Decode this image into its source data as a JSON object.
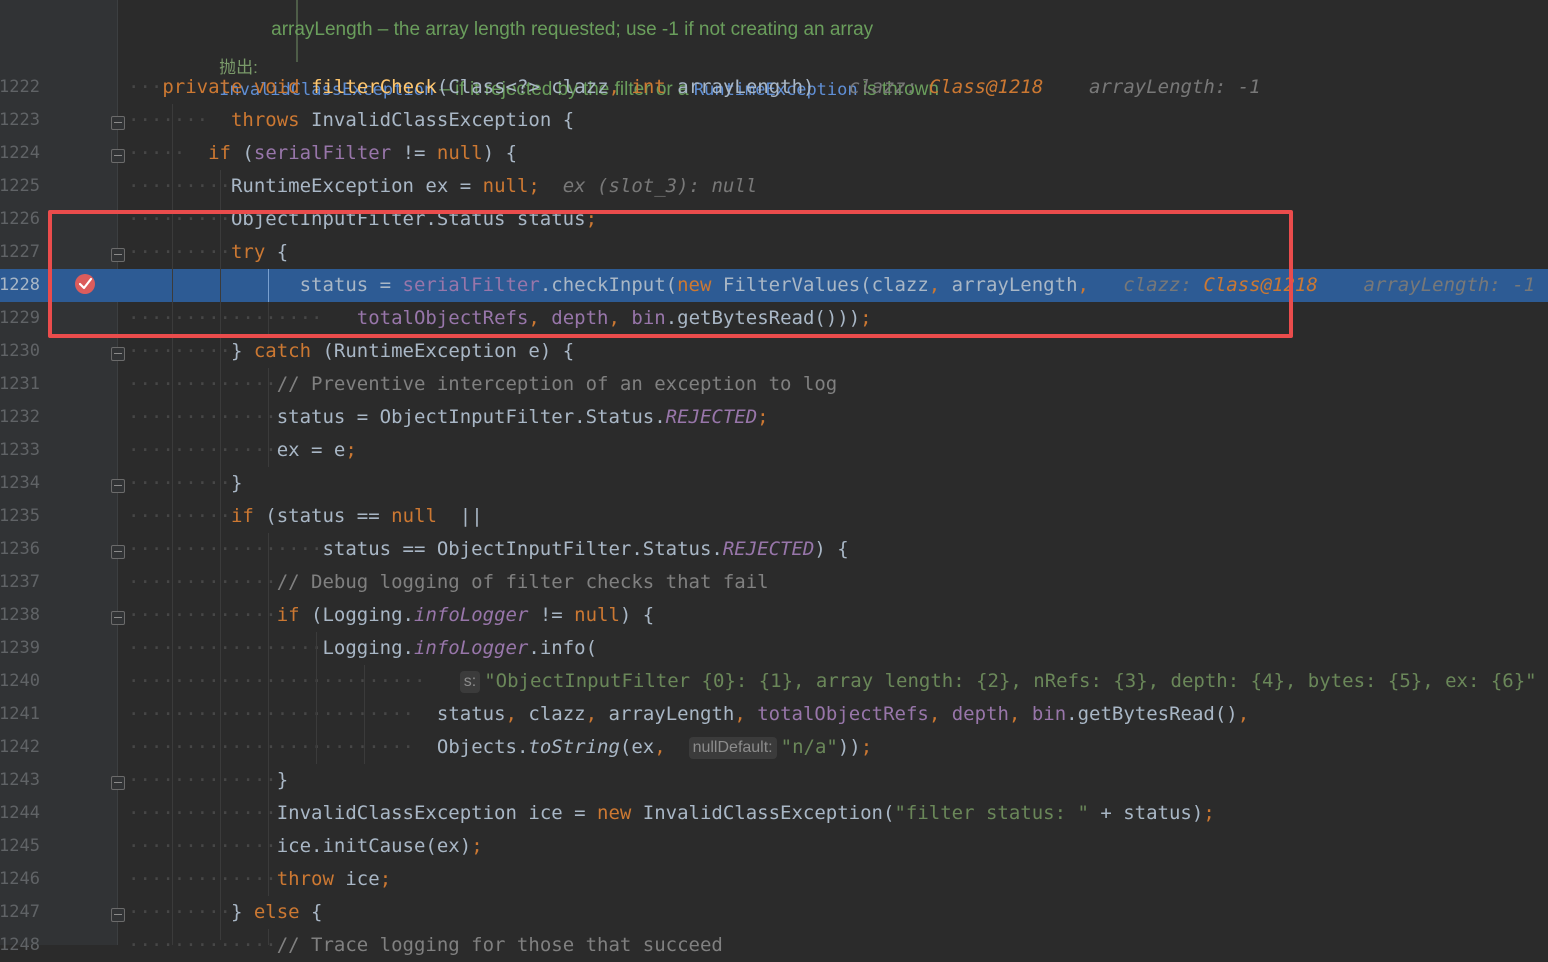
{
  "doc": {
    "param_line": "arrayLength – the array length requested; use -1 if not creating an array",
    "throws_label": "抛出:",
    "throws_ex1": "InvalidClassException",
    "throws_mid": " – if it rejected by the filter or a ",
    "throws_ex2": "RuntimeException",
    "throws_end": " is thrown"
  },
  "lines": [
    {
      "num": "1222",
      "exec": false
    },
    {
      "num": "1223",
      "exec": false
    },
    {
      "num": "1224",
      "exec": false
    },
    {
      "num": "1225",
      "exec": false
    },
    {
      "num": "1226",
      "exec": false
    },
    {
      "num": "1227",
      "exec": false
    },
    {
      "num": "1228",
      "exec": true
    },
    {
      "num": "1229",
      "exec": false
    },
    {
      "num": "1230",
      "exec": false
    },
    {
      "num": "1231",
      "exec": false
    },
    {
      "num": "1232",
      "exec": false
    },
    {
      "num": "1233",
      "exec": false
    },
    {
      "num": "1234",
      "exec": false
    },
    {
      "num": "1235",
      "exec": false
    },
    {
      "num": "1236",
      "exec": false
    },
    {
      "num": "1237",
      "exec": false
    },
    {
      "num": "1238",
      "exec": false
    },
    {
      "num": "1239",
      "exec": false
    },
    {
      "num": "1240",
      "exec": false
    },
    {
      "num": "1241",
      "exec": false
    },
    {
      "num": "1242",
      "exec": false
    },
    {
      "num": "1243",
      "exec": false
    },
    {
      "num": "1244",
      "exec": false
    },
    {
      "num": "1245",
      "exec": false
    },
    {
      "num": "1246",
      "exec": false
    },
    {
      "num": "1247",
      "exec": false
    },
    {
      "num": "1248",
      "exec": false
    }
  ],
  "code": {
    "l1222": {
      "private": "private",
      "void": "void",
      "name": "filterCheck",
      "params_a": "(Class<?> clazz",
      "comma": ",",
      "int": "int",
      "params_b": " arrayLength)",
      "hint1_k": "clazz: ",
      "hint1_v": "Class@1218",
      "hint2": "arrayLength: -1"
    },
    "l1223": {
      "throws": "throws",
      "rest": " InvalidClassException {"
    },
    "l1224": {
      "if": "if",
      "open": " (",
      "field": "serialFilter",
      "op": " != ",
      "null": "null",
      "close": ") {"
    },
    "l1225": {
      "type": "RuntimeException ex = ",
      "null": "null",
      "semi": ";",
      "hint": "ex (slot_3): null"
    },
    "l1226": {
      "text": "ObjectInputFilter.Status status",
      "semi": ";"
    },
    "l1227": {
      "try": "try",
      "rest": " {"
    },
    "l1228": {
      "lhs": "status = ",
      "field": "serialFilter",
      "call": ".checkInput(",
      "new": "new",
      "ctor": " FilterValues(clazz",
      "comma": ",",
      "arg": " arrayLength",
      "comma2": ",",
      "hint1_k": "clazz: ",
      "hint1_v": "Class@1218",
      "hint2": "arrayLength: -1"
    },
    "l1229": {
      "f1": "totalObjectRefs",
      "c1": ", ",
      "f2": "depth",
      "c2": ", ",
      "f3": "bin",
      "rest": ".getBytesRead()))",
      "semi": ";"
    },
    "l1230": {
      "brace": "} ",
      "catch": "catch",
      "rest": " (RuntimeException e) {"
    },
    "l1231": {
      "comment": "// Preventive interception of an exception to log"
    },
    "l1232": {
      "lhs": "status = ObjectInputFilter.Status.",
      "const": "REJECTED",
      "semi": ";"
    },
    "l1233": {
      "text": "ex = e",
      "semi": ";"
    },
    "l1234": {
      "text": "}"
    },
    "l1235": {
      "if": "if",
      "open": " (status == ",
      "null": "null",
      "rest": "  ||"
    },
    "l1236": {
      "lhs": "status == ObjectInputFilter.Status.",
      "const": "REJECTED",
      "rest": ") {"
    },
    "l1237": {
      "comment": "// Debug logging of filter checks that fail"
    },
    "l1238": {
      "if": "if",
      "open": " (Logging.",
      "field": "infoLogger",
      "op": " != ",
      "null": "null",
      "close": ") {"
    },
    "l1239": {
      "a": "Logging.",
      "field": "infoLogger",
      "b": ".info("
    },
    "l1240": {
      "pill": "s:",
      "str": "\"ObjectInputFilter {0}: {1}, array length: {2}, nRefs: {3}, depth: {4}, bytes: {5}, ex: {6}\""
    },
    "l1241": {
      "a": "status",
      "c1": ", ",
      "b": "clazz",
      "c2": ", ",
      "c": "arrayLength",
      "c3": ", ",
      "f1": "totalObjectRefs",
      "c4": ", ",
      "f2": "depth",
      "c5": ", ",
      "f3": "bin",
      "rest": ".getBytesRead()",
      "c6": ","
    },
    "l1242": {
      "a": "Objects.",
      "m": "toString",
      "b": "(ex",
      "c1": ", ",
      "pill": "nullDefault:",
      "str": "\"n/a\"",
      "rest": "))",
      "semi": ";"
    },
    "l1243": {
      "text": "}"
    },
    "l1244": {
      "a": "InvalidClassException ice = ",
      "new": "new",
      "b": " InvalidClassException(",
      "str": "\"filter status: \"",
      "rest": " + status)",
      "semi": ";"
    },
    "l1245": {
      "text": "ice.initCause(ex)",
      "semi": ";"
    },
    "l1246": {
      "throw": "throw",
      "rest": " ice",
      "semi": ";"
    },
    "l1247": {
      "brace": "} ",
      "else": "else",
      "rest": " {"
    },
    "l1248": {
      "comment": "// Trace logging for those that succeed"
    }
  },
  "colors": {
    "background": "#2b2b2b",
    "gutter": "#313335",
    "execution_line": "#2d5b94",
    "breakpoint": "#db5c5c",
    "highlight_box": "#ea4c4c",
    "keyword": "#cc7832",
    "method": "#ffc66d",
    "field": "#9876aa",
    "string": "#6a8759",
    "comment": "#808080"
  },
  "icons": {
    "breakpoint": "breakpoint-check-icon",
    "fold": "fold-marker-icon"
  }
}
